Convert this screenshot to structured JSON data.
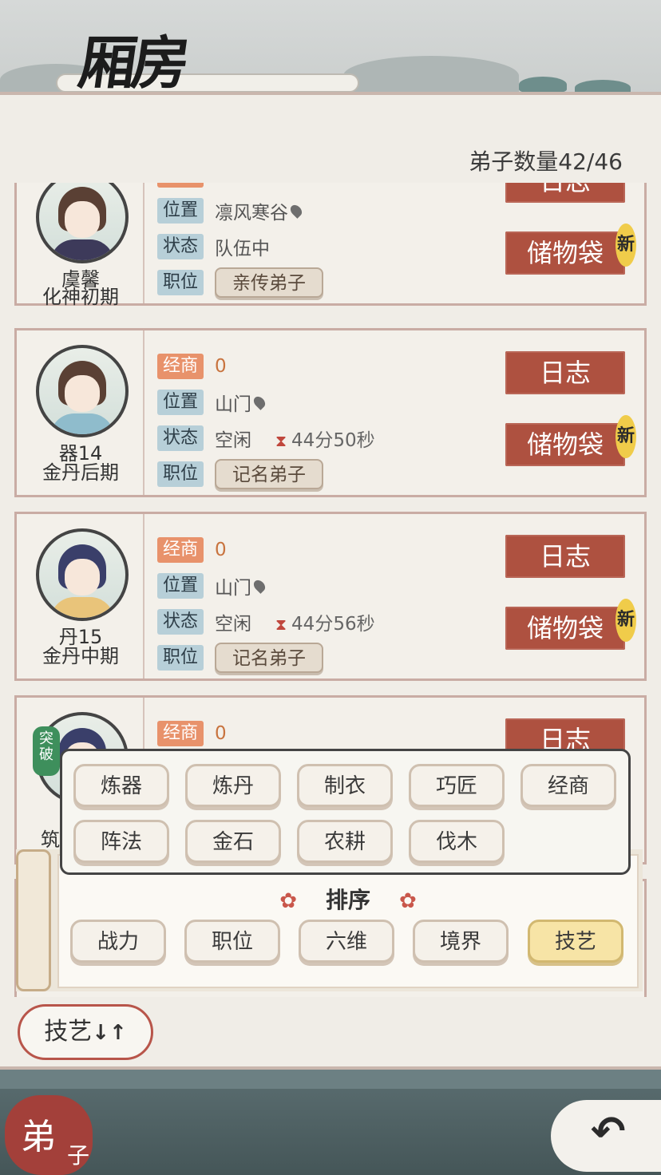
{
  "header": {
    "title": "厢房",
    "disciple_count": "弟子数量42/46"
  },
  "labels": {
    "trade": "经商",
    "location": "位置",
    "status": "状态",
    "position": "职位",
    "log": "日志",
    "bag": "储物袋",
    "new": "新",
    "break": "突破"
  },
  "disciples": [
    {
      "name": "虞馨",
      "realm": "化神初期",
      "trade_value": "",
      "location": "凛风寒谷",
      "status": "队伍中",
      "timer": "",
      "rank": "亲传弟子"
    },
    {
      "name": "器14",
      "realm": "金丹后期",
      "trade_value": "0",
      "location": "山门",
      "status": "空闲",
      "timer": "44分50秒",
      "rank": "记名弟子"
    },
    {
      "name": "丹15",
      "realm": "金丹中期",
      "trade_value": "0",
      "location": "山门",
      "status": "空闲",
      "timer": "44分56秒",
      "rank": "记名弟子"
    },
    {
      "name": "筑",
      "realm": "",
      "trade_value": "0",
      "location": "",
      "status": "",
      "timer": "",
      "rank": ""
    }
  ],
  "filters": [
    "炼器",
    "炼丹",
    "制衣",
    "巧匠",
    "经商",
    "阵法",
    "金石",
    "农耕",
    "伐木"
  ],
  "sort": {
    "title": "排序",
    "options": [
      "战力",
      "职位",
      "六维",
      "境界",
      "技艺"
    ],
    "selected": "技艺"
  },
  "sort_toggle": {
    "label": "技艺",
    "arrows": "↓↑"
  },
  "bottom_nav": {
    "disciple_big": "弟",
    "disciple_small": "子",
    "back": "↶"
  },
  "colors": {
    "accent_red": "#ae5140",
    "tag_blue": "#b7cfd8",
    "tag_orange": "#e8926b",
    "selected_chip": "#f7e4a6"
  }
}
